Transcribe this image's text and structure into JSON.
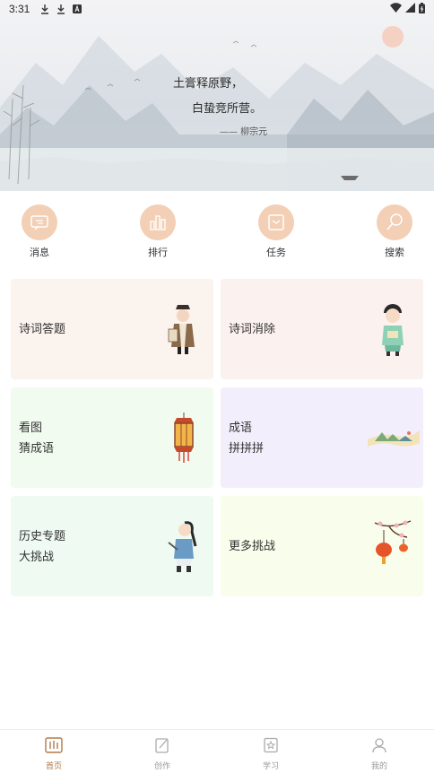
{
  "status_bar": {
    "time": "3:31"
  },
  "banner": {
    "line1": "土膏释原野，",
    "line2": "白蛰竞所营。",
    "author": "—— 柳宗元"
  },
  "quick_actions": [
    {
      "label": "消息",
      "icon": "message-icon"
    },
    {
      "label": "排行",
      "icon": "ranking-icon"
    },
    {
      "label": "任务",
      "icon": "task-icon"
    },
    {
      "label": "搜索",
      "icon": "search-icon"
    }
  ],
  "cards": [
    {
      "lines": [
        "诗词答题"
      ],
      "bg": "#faf3ee",
      "art": "scholar-figure"
    },
    {
      "lines": [
        "诗词消除"
      ],
      "bg": "#fbf1ee",
      "art": "boy-figure"
    },
    {
      "lines": [
        "看图",
        "猜成语"
      ],
      "bg": "#f1fbef",
      "art": "lantern"
    },
    {
      "lines": [
        "成语",
        "拼拼拼"
      ],
      "bg": "#f3eefb",
      "art": "landscape-scroll"
    },
    {
      "lines": [
        "历史专题",
        "大挑战"
      ],
      "bg": "#eefaf2",
      "art": "warrior-figure"
    },
    {
      "lines": [
        "更多挑战"
      ],
      "bg": "#f9fdec",
      "art": "plum-blossom-lanterns"
    }
  ],
  "bottom_nav": [
    {
      "label": "首页",
      "icon": "home-icon",
      "active": true
    },
    {
      "label": "创作",
      "icon": "create-icon",
      "active": false
    },
    {
      "label": "学习",
      "icon": "study-icon",
      "active": false
    },
    {
      "label": "我的",
      "icon": "profile-icon",
      "active": false
    }
  ],
  "colors": {
    "accent": "#b07a4a",
    "icon_circle": "#f2cfb5"
  }
}
